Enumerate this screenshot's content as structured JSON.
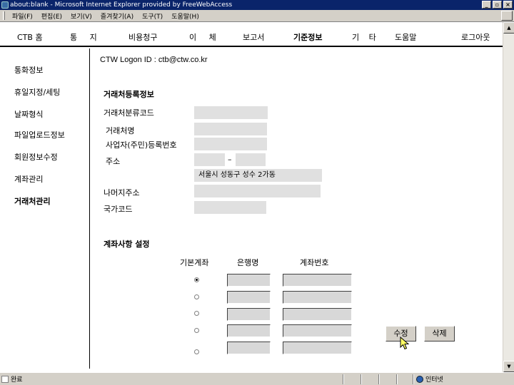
{
  "window": {
    "title": "about:blank - Microsoft Internet Explorer provided by FreeWebAccess"
  },
  "menubar": {
    "items": [
      "파일(F)",
      "편집(E)",
      "보기(V)",
      "즐겨찾기(A)",
      "도구(T)",
      "도움말(H)"
    ]
  },
  "nav": {
    "items": [
      "CTB 홈",
      "통 지",
      "비용청구",
      "이 체",
      "보고서",
      "기준정보",
      "기 타",
      "도움말",
      "로그아웃"
    ],
    "active": "기준정보"
  },
  "sidebar": {
    "items": [
      "통화정보",
      "휴일지정/세팅",
      "날짜형식",
      "파일업로드정보",
      "회원정보수정",
      "계좌관리",
      "거래처관리"
    ],
    "active": "거래처관리"
  },
  "main": {
    "logon": "CTW Logon ID : ctb@ctw.co.kr",
    "registration": {
      "title": "거래처등록정보",
      "labels": {
        "category_code": "거래처분류코드",
        "name": "거래처명",
        "business_no": "사업자(주민)등록번호",
        "address": "주소",
        "address_rest": "나머지주소",
        "country_code": "국가코드"
      },
      "values": {
        "category_code": "",
        "name": "",
        "business_no": "",
        "zip1": "",
        "zip2": "",
        "address": "서울시 성동구 성수 2가동",
        "address_rest": "",
        "country_code": ""
      },
      "zip_dash": "–"
    },
    "account": {
      "title": "계좌사항 설정",
      "headers": {
        "default": "기본계좌",
        "bank": "은행명",
        "account_no": "계좌번호"
      },
      "rows": [
        {
          "default": true,
          "bank": "",
          "account_no": ""
        },
        {
          "default": false,
          "bank": "",
          "account_no": ""
        },
        {
          "default": false,
          "bank": "",
          "account_no": ""
        },
        {
          "default": false,
          "bank": "",
          "account_no": ""
        },
        {
          "default": false,
          "bank": "",
          "account_no": ""
        }
      ]
    },
    "buttons": {
      "edit": "수정",
      "delete": "삭제"
    }
  },
  "statusbar": {
    "left": "완료",
    "zone": "인터넷"
  }
}
